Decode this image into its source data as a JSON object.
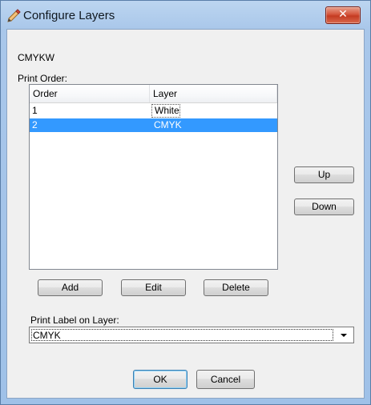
{
  "window": {
    "title": "Configure Layers",
    "close_glyph": "✕"
  },
  "profile_name": "CMYKW",
  "print_order": {
    "label": "Print Order:",
    "columns": [
      "Order",
      "Layer"
    ],
    "rows": [
      {
        "order": "1",
        "layer": "White",
        "selected": false
      },
      {
        "order": "2",
        "layer": "CMYK",
        "selected": true
      }
    ]
  },
  "buttons": {
    "up": "Up",
    "down": "Down",
    "add": "Add",
    "edit": "Edit",
    "delete": "Delete",
    "ok": "OK",
    "cancel": "Cancel"
  },
  "label_layer": {
    "label": "Print Label on Layer:",
    "selected": "CMYK"
  },
  "colors": {
    "selection": "#3399ff",
    "close_button": "#c43b22"
  },
  "icons": {
    "title": "pencil-edit-icon",
    "combo_arrow": "chevron-down-icon"
  }
}
